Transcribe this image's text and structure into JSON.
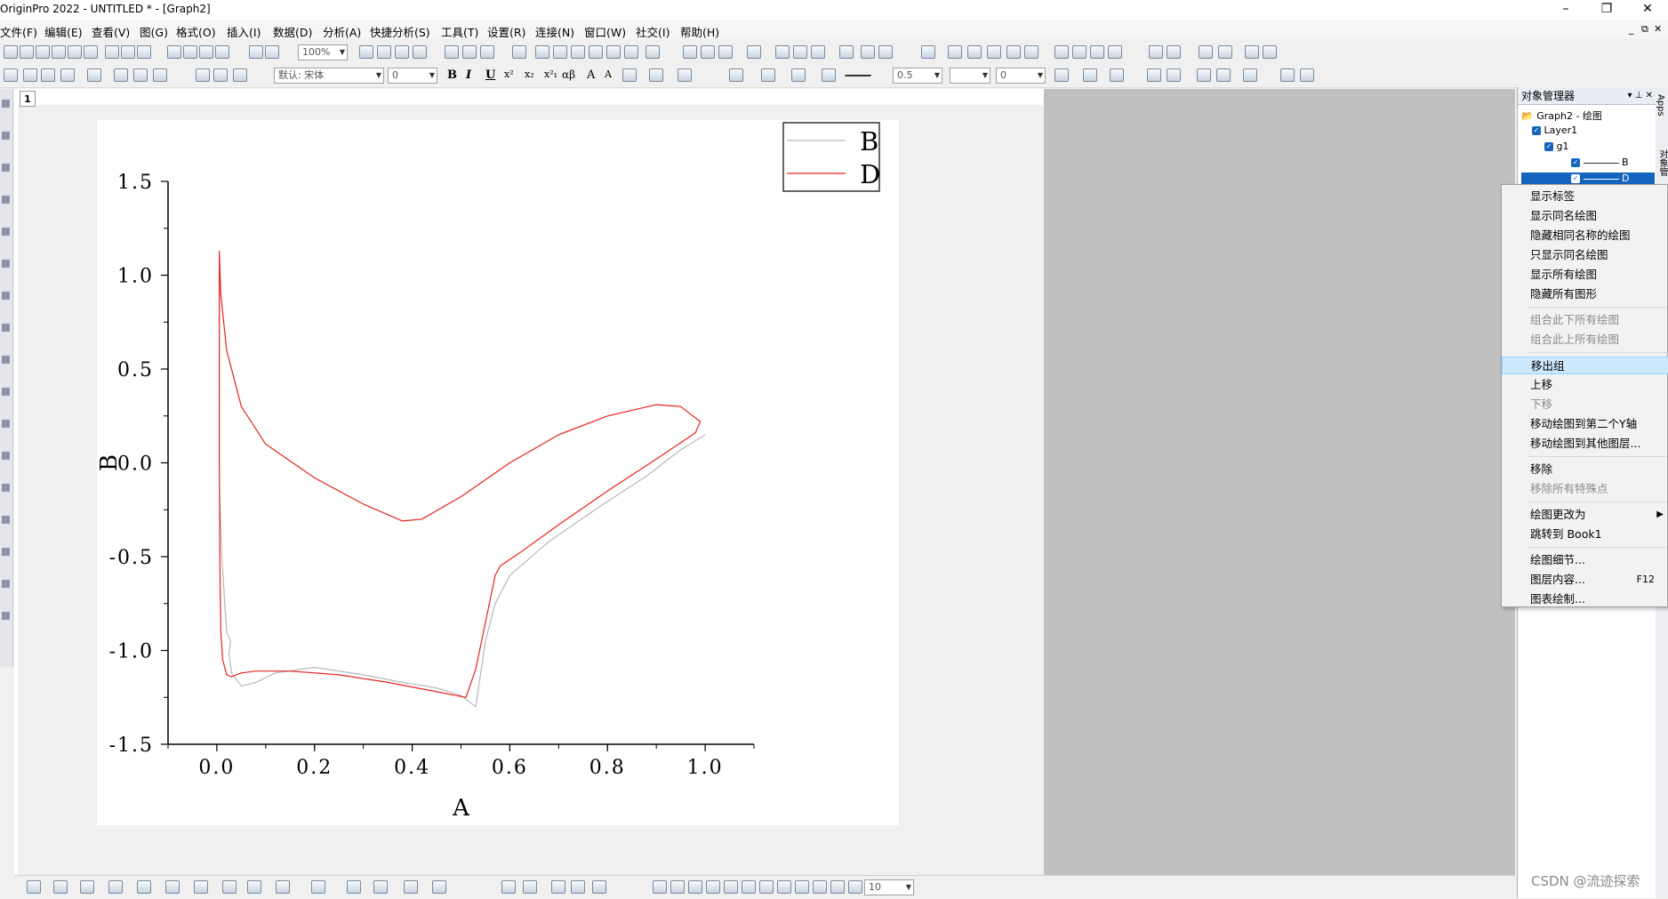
{
  "window": {
    "title": "OriginPro 2022 - UNTITLED * - [Graph2]",
    "min": "–",
    "max": "❐",
    "close": "✕",
    "mdi_controls": [
      "_",
      "⧉",
      "✕"
    ]
  },
  "menu": [
    "文件(F)",
    "编辑(E)",
    "查看(V)",
    "图(G)",
    "格式(O)",
    "插入(I)",
    "数据(D)",
    "分析(A)",
    "快捷分析(S)",
    "工具(T)",
    "设置(R)",
    "连接(N)",
    "窗口(W)",
    "社交(I)",
    "帮助(H)"
  ],
  "toolbar": {
    "zoom": "100%",
    "font_name": "默认: 宋体",
    "font_size": "0",
    "line_width": "0.5",
    "line_opacity": "0",
    "bottom_size": "10",
    "text_buttons": [
      "B",
      "I",
      "U",
      "x²",
      "x₂",
      "x²₁",
      "αβ",
      "A",
      "A"
    ]
  },
  "page_tab": "1",
  "chart_data": {
    "type": "line",
    "xlabel": "A",
    "ylabel": "B",
    "xlim": [
      -0.1,
      1.1
    ],
    "ylim": [
      -1.5,
      1.5
    ],
    "xticks": [
      "0.0",
      "0.2",
      "0.4",
      "0.6",
      "0.8",
      "1.0"
    ],
    "yticks": [
      "1.5",
      "1.0",
      "0.5",
      "0.0",
      "-0.5",
      "-1.0",
      "-1.5"
    ],
    "xtick_values": [
      0.0,
      0.2,
      0.4,
      0.6,
      0.8,
      1.0
    ],
    "ytick_values": [
      1.5,
      1.0,
      0.5,
      0.0,
      -0.5,
      -1.0,
      -1.5
    ],
    "legend_position": "top-right",
    "series": [
      {
        "name": "B",
        "color": "#b8b8b8",
        "x": [
          1.0,
          0.95,
          0.88,
          0.78,
          0.68,
          0.6,
          0.57,
          0.55,
          0.53,
          0.5,
          0.45,
          0.38,
          0.3,
          0.2,
          0.12,
          0.08,
          0.05,
          0.03,
          0.025,
          0.028,
          0.02,
          0.01,
          0.005,
          0.005,
          0.005
        ],
        "y": [
          0.15,
          0.07,
          -0.07,
          -0.24,
          -0.42,
          -0.6,
          -0.75,
          -0.95,
          -1.3,
          -1.24,
          -1.2,
          -1.17,
          -1.13,
          -1.09,
          -1.12,
          -1.17,
          -1.19,
          -1.12,
          -1.02,
          -0.95,
          -0.9,
          -0.5,
          -0.1,
          0.5,
          1.1
        ],
        "note": "approximate"
      },
      {
        "name": "D",
        "color": "#e8231d",
        "x": [
          0.005,
          0.008,
          0.02,
          0.05,
          0.1,
          0.2,
          0.3,
          0.38,
          0.42,
          0.5,
          0.6,
          0.7,
          0.8,
          0.9,
          0.95,
          0.99,
          0.98,
          0.9,
          0.8,
          0.7,
          0.62,
          0.58,
          0.57,
          0.55,
          0.53,
          0.51,
          0.45,
          0.35,
          0.25,
          0.15,
          0.08,
          0.05,
          0.03,
          0.02,
          0.012,
          0.008,
          0.006,
          0.005,
          0.005,
          0.005
        ],
        "y": [
          1.13,
          0.9,
          0.6,
          0.3,
          0.1,
          -0.08,
          -0.22,
          -0.31,
          -0.3,
          -0.18,
          0.0,
          0.15,
          0.25,
          0.31,
          0.3,
          0.22,
          0.16,
          0.02,
          -0.15,
          -0.33,
          -0.48,
          -0.55,
          -0.6,
          -0.85,
          -1.1,
          -1.25,
          -1.22,
          -1.17,
          -1.13,
          -1.11,
          -1.11,
          -1.12,
          -1.14,
          -1.13,
          -1.05,
          -0.9,
          -0.5,
          0.0,
          0.5,
          1.13
        ],
        "note": "approximate"
      }
    ]
  },
  "object_manager": {
    "title": "对象管理器",
    "pin": "▾ ⊥ ✕",
    "tree": [
      {
        "label": "Graph2 - 绘图"
      },
      {
        "label": "Layer1"
      },
      {
        "label": "g1"
      },
      {
        "label": "B"
      },
      {
        "label": "D"
      }
    ]
  },
  "side_tabs": [
    "Apps",
    "对象管"
  ],
  "context_menu": {
    "items": [
      {
        "label": "显示标签",
        "state": "normal"
      },
      {
        "label": "显示同名绘图",
        "state": "normal"
      },
      {
        "label": "隐藏相同名称的绘图",
        "state": "normal"
      },
      {
        "label": "只显示同名绘图",
        "state": "normal"
      },
      {
        "label": "显示所有绘图",
        "state": "normal"
      },
      {
        "label": "隐藏所有图形",
        "state": "normal"
      },
      {
        "label": "组合此下所有绘图",
        "state": "disabled"
      },
      {
        "label": "组合此上所有绘图",
        "state": "disabled"
      },
      {
        "label": "移出组",
        "state": "highlighted"
      },
      {
        "label": "上移",
        "state": "normal"
      },
      {
        "label": "下移",
        "state": "disabled"
      },
      {
        "label": "移动绘图到第二个Y轴",
        "state": "normal"
      },
      {
        "label": "移动绘图到其他图层...",
        "state": "normal"
      },
      {
        "label": "移除",
        "state": "normal"
      },
      {
        "label": "移除所有特殊点",
        "state": "disabled"
      },
      {
        "label": "绘图更改为",
        "state": "normal",
        "submenu": "▶"
      },
      {
        "label": "跳转到 Book1",
        "state": "normal"
      },
      {
        "label": "绘图细节...",
        "state": "normal"
      },
      {
        "label": "图层内容...",
        "state": "normal",
        "shortcut": "F12"
      },
      {
        "label": "图表绘制...",
        "state": "normal"
      }
    ]
  },
  "watermark": "CSDN @流迹探索"
}
